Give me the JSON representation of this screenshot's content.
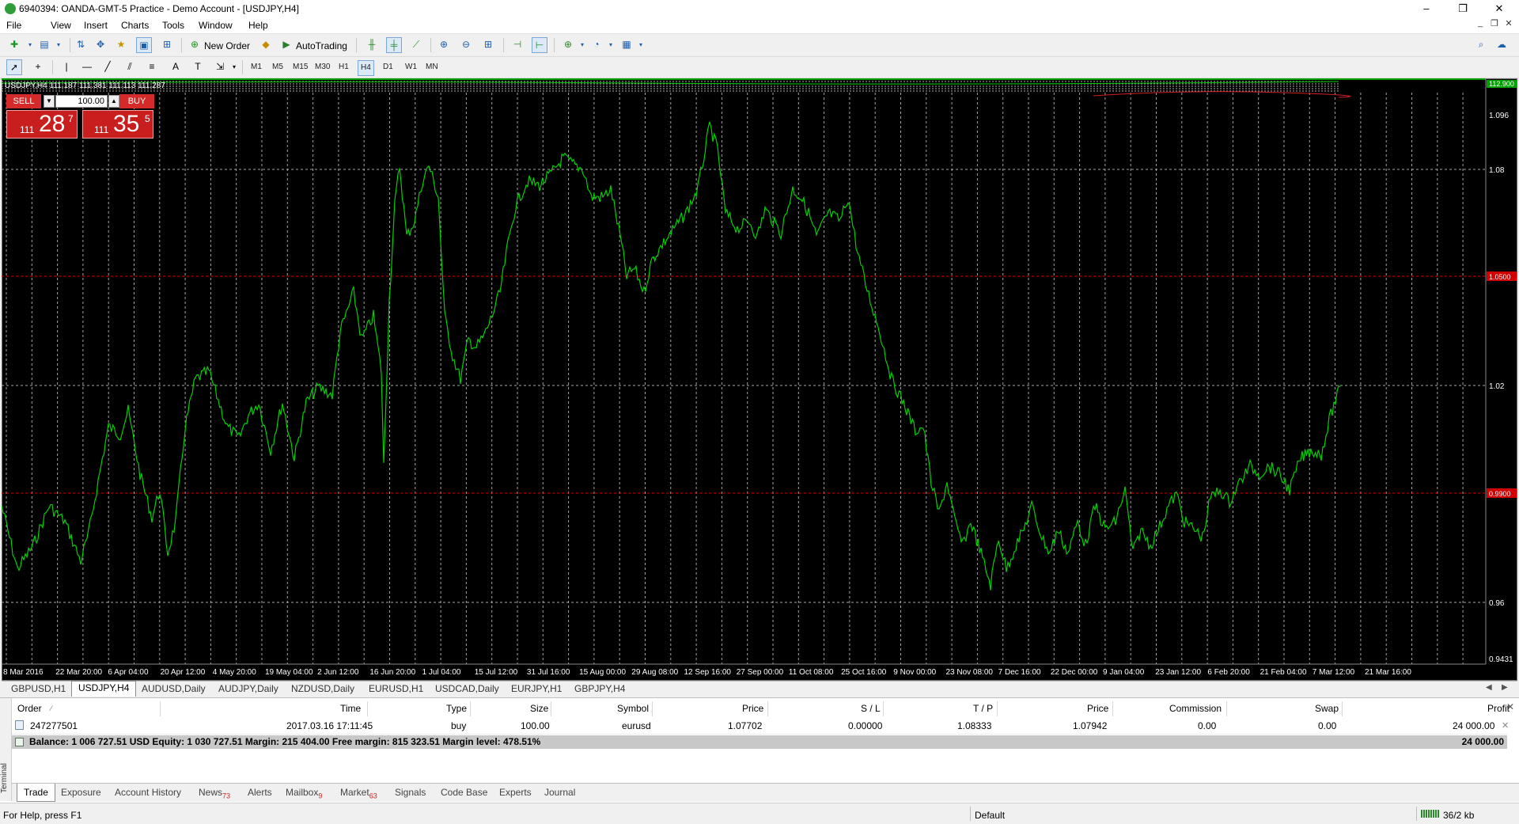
{
  "window": {
    "title": "6940394: OANDA-GMT-5 Practice - Demo Account - [USDJPY,H4]",
    "minimize": "–",
    "restore": "❐",
    "close": "✕"
  },
  "menu": [
    "File",
    "View",
    "Insert",
    "Charts",
    "Tools",
    "Window",
    "Help"
  ],
  "toolbar": {
    "new_order": "New Order",
    "auto_trading": "AutoTrading"
  },
  "timeframes": [
    "M1",
    "M5",
    "M15",
    "M30",
    "H1",
    "H4",
    "D1",
    "W1",
    "MN"
  ],
  "active_timeframe": "H4",
  "chart": {
    "header": "USDJPY,H4  111.187 111.381 111.113 111.287",
    "price_labels": [
      "1.096",
      "1.08",
      "1.02",
      "0.96",
      "0.9431"
    ],
    "level_labels": [
      "1.0500",
      "0.9900"
    ],
    "top_label": "112.900",
    "time_labels": [
      "8 Mar 2016",
      "22 Mar 20:00",
      "6 Apr 04:00",
      "20 Apr 12:00",
      "4 May 20:00",
      "19 May 04:00",
      "2 Jun 12:00",
      "16 Jun 20:00",
      "1 Jul 04:00",
      "15 Jul 12:00",
      "31 Jul 16:00",
      "15 Aug 00:00",
      "29 Aug 08:00",
      "12 Sep 16:00",
      "27 Sep 00:00",
      "11 Oct 08:00",
      "25 Oct 16:00",
      "9 Nov 00:00",
      "23 Nov 08:00",
      "7 Dec 16:00",
      "22 Dec 00:00",
      "9 Jan 04:00",
      "23 Jan 12:00",
      "6 Feb 20:00",
      "21 Feb 04:00",
      "7 Mar 12:00",
      "21 Mar 16:00"
    ],
    "colors": {
      "background": "#000000",
      "line": "#00d000",
      "grid": "#c0c0c0",
      "level": "#d00000"
    }
  },
  "oneclick": {
    "sell_label": "SELL",
    "buy_label": "BUY",
    "lot": "100.00",
    "sell_price": {
      "prefix": "111",
      "big": "28",
      "sup": "7"
    },
    "buy_price": {
      "prefix": "111",
      "big": "35",
      "sup": "5"
    }
  },
  "symbol_tabs": [
    "GBPUSD,H1",
    "USDJPY,H4",
    "AUDUSD,Daily",
    "AUDJPY,Daily",
    "NZDUSD,Daily",
    "EURUSD,H1",
    "USDCAD,Daily",
    "EURJPY,H1",
    "GBPJPY,H4"
  ],
  "active_symbol_tab": "USDJPY,H4",
  "terminal": {
    "label": "Terminal",
    "columns": [
      "Order",
      "Time",
      "Type",
      "Size",
      "Symbol",
      "Price",
      "S / L",
      "T / P",
      "Price",
      "Commission",
      "Swap",
      "Profit"
    ],
    "order": {
      "id": "247277501",
      "time": "2017.03.16 17:11:45",
      "type": "buy",
      "size": "100.00",
      "symbol": "eurusd",
      "price": "1.07702",
      "sl": "0.00000",
      "tp": "1.08333",
      "current_price": "1.07942",
      "commission": "0.00",
      "swap": "0.00",
      "profit": "24 000.00"
    },
    "balance_line": "Balance: 1 006 727.51 USD  Equity: 1 030 727.51  Margin: 215 404.00  Free margin: 815 323.51  Margin level: 478.51%",
    "balance_profit": "24 000.00",
    "tabs": [
      {
        "label": "Trade",
        "badge": ""
      },
      {
        "label": "Exposure",
        "badge": ""
      },
      {
        "label": "Account History",
        "badge": ""
      },
      {
        "label": "News",
        "badge": "73"
      },
      {
        "label": "Alerts",
        "badge": ""
      },
      {
        "label": "Mailbox",
        "badge": "9"
      },
      {
        "label": "Market",
        "badge": "63"
      },
      {
        "label": "Signals",
        "badge": ""
      },
      {
        "label": "Code Base",
        "badge": ""
      },
      {
        "label": "Experts",
        "badge": ""
      },
      {
        "label": "Journal",
        "badge": ""
      }
    ]
  },
  "status": {
    "help": "For Help, press F1",
    "profile": "Default",
    "traffic": "36/2 kb"
  }
}
